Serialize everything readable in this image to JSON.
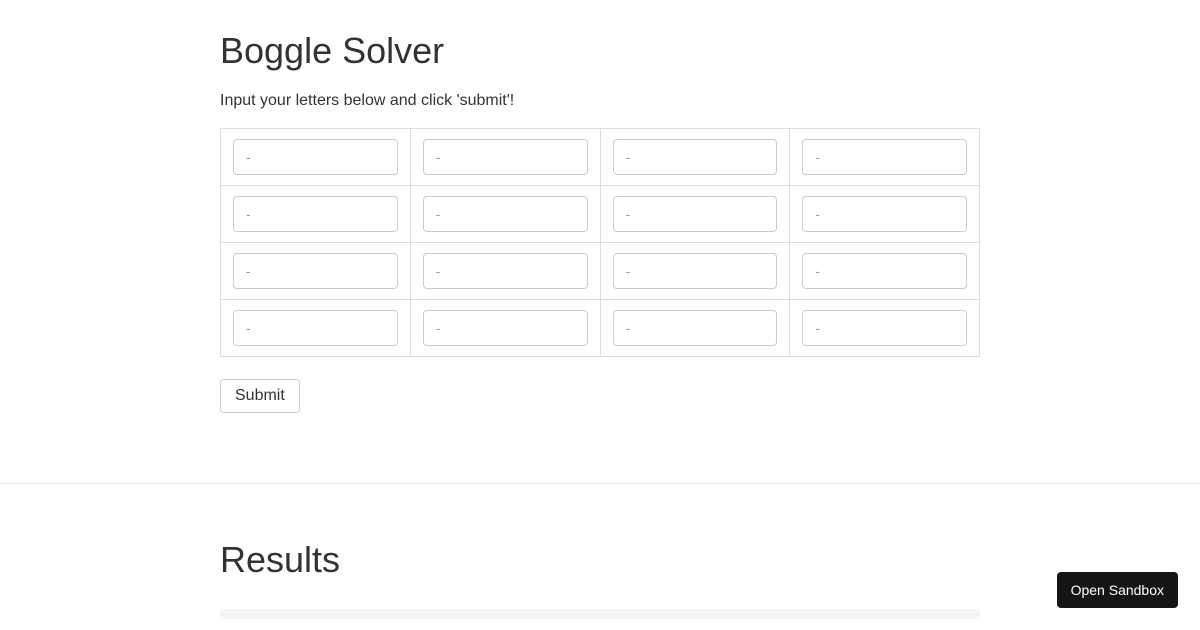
{
  "header": {
    "title": "Boggle Solver",
    "instructions": "Input your letters below and click 'submit'!"
  },
  "grid": {
    "rows": 4,
    "cols": 4,
    "placeholder": "-",
    "cells": [
      [
        "",
        "",
        "",
        ""
      ],
      [
        "",
        "",
        "",
        ""
      ],
      [
        "",
        "",
        "",
        ""
      ],
      [
        "",
        "",
        "",
        ""
      ]
    ]
  },
  "actions": {
    "submit_label": "Submit"
  },
  "results": {
    "heading": "Results"
  },
  "sandbox": {
    "button_label": "Open Sandbox"
  }
}
